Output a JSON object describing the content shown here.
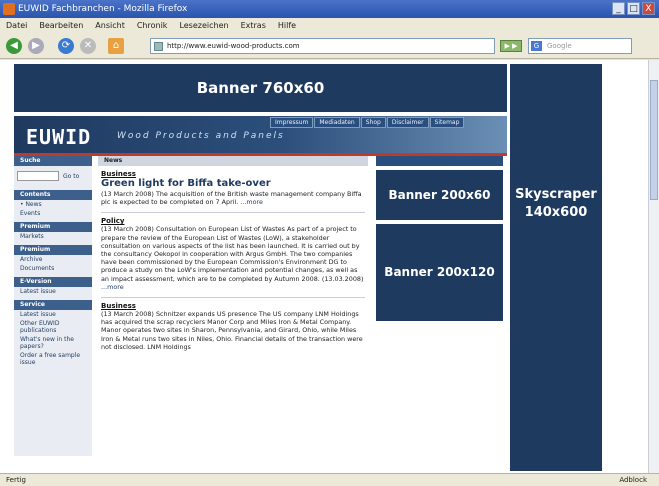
{
  "window": {
    "title": "EUWID Fachbranchen - Mozilla Firefox",
    "buttons": [
      "_",
      "□",
      "X"
    ]
  },
  "menu": [
    "Datei",
    "Bearbeiten",
    "Ansicht",
    "Chronik",
    "Lesezeichen",
    "Extras",
    "Hilfe"
  ],
  "navbar": {
    "url": "http://www.euwid-wood-products.com",
    "go_label": "▶ ▶",
    "search_placeholder": "Google",
    "icons": [
      "back-icon",
      "forward-icon",
      "reload-icon",
      "stop-icon",
      "home-icon",
      "go-icon",
      "search-icon"
    ]
  },
  "page": {
    "banner_top": "Banner 760x60",
    "logo": "EUWID",
    "logo_sub": "Wood Products and Panels",
    "toplinks": [
      "Impressum",
      "Mediadaten",
      "Shop",
      "Disclaimer",
      "Sitemap"
    ],
    "sidebar": {
      "search_head": "Suche",
      "search_go": "Go to",
      "sections": [
        {
          "head": "Contents",
          "items": [
            "• News",
            "Events"
          ]
        },
        {
          "head": "Premium",
          "items": [
            "Markets"
          ]
        },
        {
          "head": "Premium",
          "items": [
            "Archive",
            "Documents"
          ]
        },
        {
          "head": "E-Version",
          "items": [
            "Latest issue"
          ]
        },
        {
          "head": "Service",
          "items": [
            "Latest issue",
            "Other EUWID publications",
            "What's new in the papers?",
            "Order a free sample issue"
          ]
        }
      ]
    },
    "news_head": "News",
    "articles": [
      {
        "category": "Business",
        "headline": "Green light for Biffa take-over",
        "body": "(13 March 2008) The acquisition of the British waste management company Biffa plc is expected to be completed on 7 April.",
        "more": "...more"
      },
      {
        "category": "Policy",
        "headline": "",
        "body": "(13 March 2008) Consultation on European List of Wastes As part of a project to prepare the review of the European List of Wastes (LoW), a stakeholder consultation on various aspects of the list has been launched. It is carried out by the consultancy Oekopol in cooperation with Argus GmbH. The two companies have been commissioned by the European Commission's Environment DG to produce a study on the LoW's implementation and potential changes, as well as an impact assessment, which are to be completed by Autumn 2008. (13.03.2008)",
        "more": "...more"
      },
      {
        "category": "Business",
        "headline": "",
        "body": "(13 March 2008) Schnitzer expands US presence The US company LNM Holdings has acquired the scrap recyclers Manor Corp and Miles Iron & Metal Company. Manor operates two sites in Sharon, Pennsylvania, and Girard, Ohio, while Miles Iron & Metal runs two sites in Niles, Ohio. Financial details of the transaction were not disclosed. LNM Holdings",
        "more": ""
      }
    ],
    "banner_200x60": "Banner 200x60",
    "banner_200x120": "Banner 200x120",
    "skyscraper": [
      "Skyscraper",
      "140x600"
    ]
  },
  "status": {
    "left": "Fertig",
    "right": "Adblock"
  },
  "colors": {
    "navy": "#1f3a5f",
    "sidebar_head": "#3d5f8c",
    "chrome": "#ece9d8",
    "title_blue": "#2a55ad"
  }
}
